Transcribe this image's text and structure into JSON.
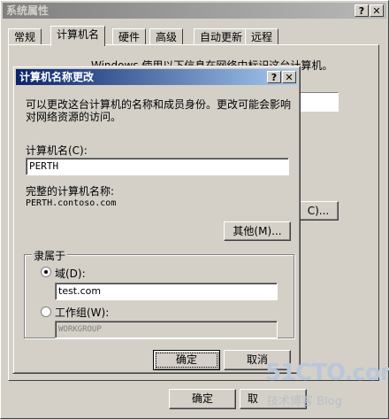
{
  "outer": {
    "title": "系统属性",
    "help_btn": "?",
    "close_btn": "✕",
    "tabs": [
      "常规",
      "计算机名",
      "硬件",
      "高级",
      "自动更新",
      "远程"
    ],
    "active_tab": 1,
    "partial_text": "Windows 使用以下信息在网络中标识这台计算机。",
    "partial_button": "C)...",
    "ok_label": "确定",
    "cancel_label": "取"
  },
  "dialog": {
    "title": "计算机名称更改",
    "help_btn": "?",
    "close_btn": "✕",
    "description_line1": "可以更改这台计算机的名称和成员身份。更改可能会影响",
    "description_line2": "对网络资源的访问。",
    "computer_name_label": "计算机名(C):",
    "computer_name_value": "PERTH",
    "full_name_label": "完整的计算机名称:",
    "full_name_value": "PERTH.contoso.com",
    "more_button": "其他(M)...",
    "member_of_legend": "隶属于",
    "domain_label": "域(D):",
    "domain_value": "test.com",
    "workgroup_label": "工作组(W):",
    "workgroup_value": "WORKGROUP",
    "ok_label": "确定",
    "cancel_label": "取消"
  },
  "watermark": {
    "line1": "51CTO.com",
    "line2": "技术博客 Blog"
  }
}
